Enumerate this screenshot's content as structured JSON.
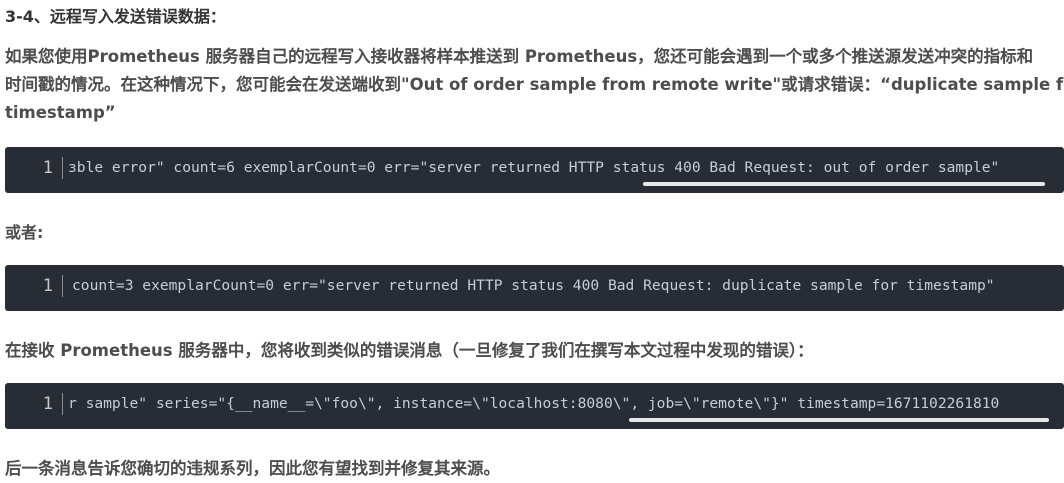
{
  "section_heading": "3-4、远程写入发送错误数据：",
  "paragraphs": {
    "intro_line1": "如果您使用Prometheus 服务器自己的远程写入接收器将样本推送到 Prometheus，您还可能会遇到一个或多个推送源发送冲突的指标和",
    "intro_line2": "时间戳的情况。在这种情况下，您可能会在发送端收到\"Out of order sample from remote write\"或请求错误：“duplicate sample for",
    "intro_line3": "timestamp”",
    "or": "或者:",
    "receiver": "在接收 Prometheus 服务器中，您将收到类似的错误消息（一旦修复了我们在撰写本文过程中发现的错误）：",
    "conclusion": "后一条消息告诉您确切的违规系列，因此您有望找到并修复其来源。"
  },
  "code_blocks": [
    {
      "line_number": "1",
      "text": "ɜble error\" count=6 exemplarCount=0 err=\"server returned HTTP status 400 Bad Request: out of order sample\"",
      "scroll_position": 1.0
    },
    {
      "line_number": "1",
      "text": "count=3 exemplarCount=0 err=\"server returned HTTP status 400 Bad Request: duplicate sample for timestamp\"",
      "scroll_position": 1.0
    },
    {
      "line_number": "1",
      "text": "r sample\" series=\"{__name__=\\\"foo\\\", instance=\\\"localhost:8080\\\", job=\\\"remote\\\"}\" timestamp=1671102261810",
      "scroll_position": 1.0
    }
  ],
  "colors": {
    "code_background": "#282c34",
    "code_text": "#c8ccd4",
    "body_text": "#4d4d4d",
    "scrollbar_thumb": "#e6e6e6"
  }
}
